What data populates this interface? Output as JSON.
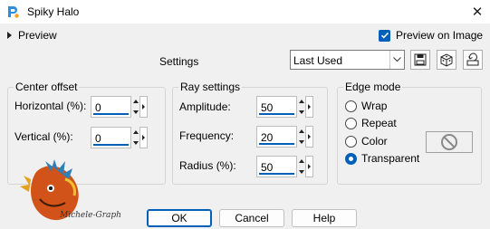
{
  "window": {
    "title": "Spiky Halo"
  },
  "preview": {
    "label": "Preview"
  },
  "preview_on_image": {
    "label": "Preview on Image",
    "checked": true
  },
  "settings": {
    "label": "Settings",
    "preset_value": "Last Used"
  },
  "center_offset": {
    "title": "Center offset",
    "horizontal_label": "Horizontal (%):",
    "horizontal_value": "0",
    "vertical_label": "Vertical (%):",
    "vertical_value": "0"
  },
  "ray_settings": {
    "title": "Ray settings",
    "amplitude_label": "Amplitude:",
    "amplitude_value": "50",
    "frequency_label": "Frequency:",
    "frequency_value": "20",
    "radius_label": "Radius (%):",
    "radius_value": "50"
  },
  "edge_mode": {
    "title": "Edge mode",
    "options": [
      "Wrap",
      "Repeat",
      "Color",
      "Transparent"
    ],
    "selected": "Transparent"
  },
  "buttons": {
    "ok": "OK",
    "cancel": "Cancel",
    "help": "Help"
  },
  "watermark": {
    "text": "Michele-Graph"
  },
  "colors": {
    "accent": "#005fb8"
  }
}
